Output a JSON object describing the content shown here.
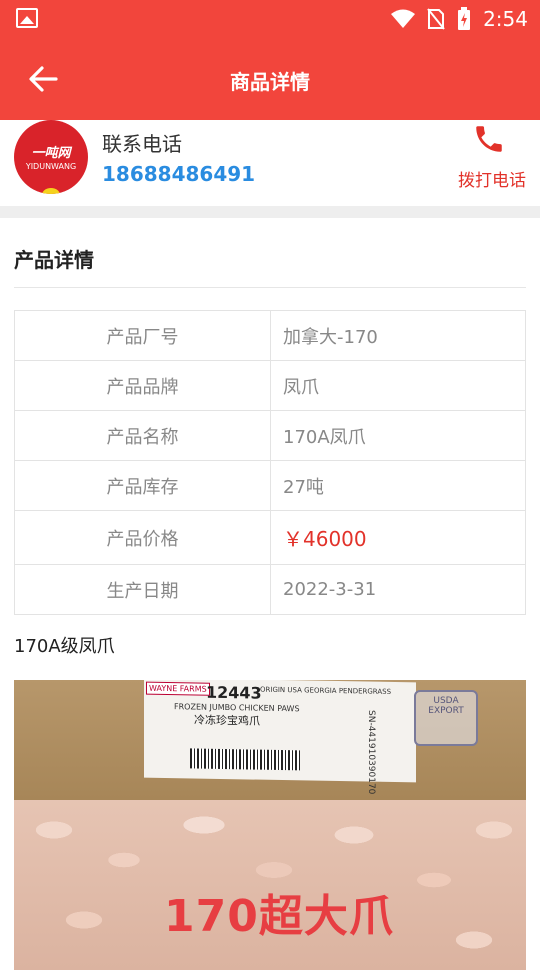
{
  "status_bar": {
    "time": "2:54"
  },
  "header": {
    "title": "商品详情"
  },
  "contact": {
    "logo_text": "一吨网",
    "logo_sub": "YIDUNWANG",
    "label": "联系电话",
    "phone": "18688486491",
    "call_label": "拨打电话"
  },
  "section": {
    "title": "产品详情"
  },
  "details": [
    {
      "key": "产品厂号",
      "value": "加拿大-170"
    },
    {
      "key": "产品品牌",
      "value": "凤爪"
    },
    {
      "key": "产品名称",
      "value": "170A凤爪"
    },
    {
      "key": "产品库存",
      "value": "27吨"
    },
    {
      "key": "产品价格",
      "value": "￥46000"
    },
    {
      "key": "生产日期",
      "value": "2022-3-31"
    }
  ],
  "description": "170A级凤爪",
  "photo": {
    "overlay_text": "170超大爪",
    "box_brand": "WAYNE FARMS",
    "box_number": "12443",
    "box_origin": "ORIGIN USA GEORGIA PENDERGRASS",
    "box_product": "FROZEN JUMBO CHICKEN PAWS",
    "box_product_cn": "冷冻珍宝鸡爪",
    "stamp": "USDA EXPORT",
    "serial": "SN-441910390170"
  },
  "colors": {
    "accent": "#f2453c",
    "phone": "#2a8ce0",
    "price": "#e2322a"
  }
}
